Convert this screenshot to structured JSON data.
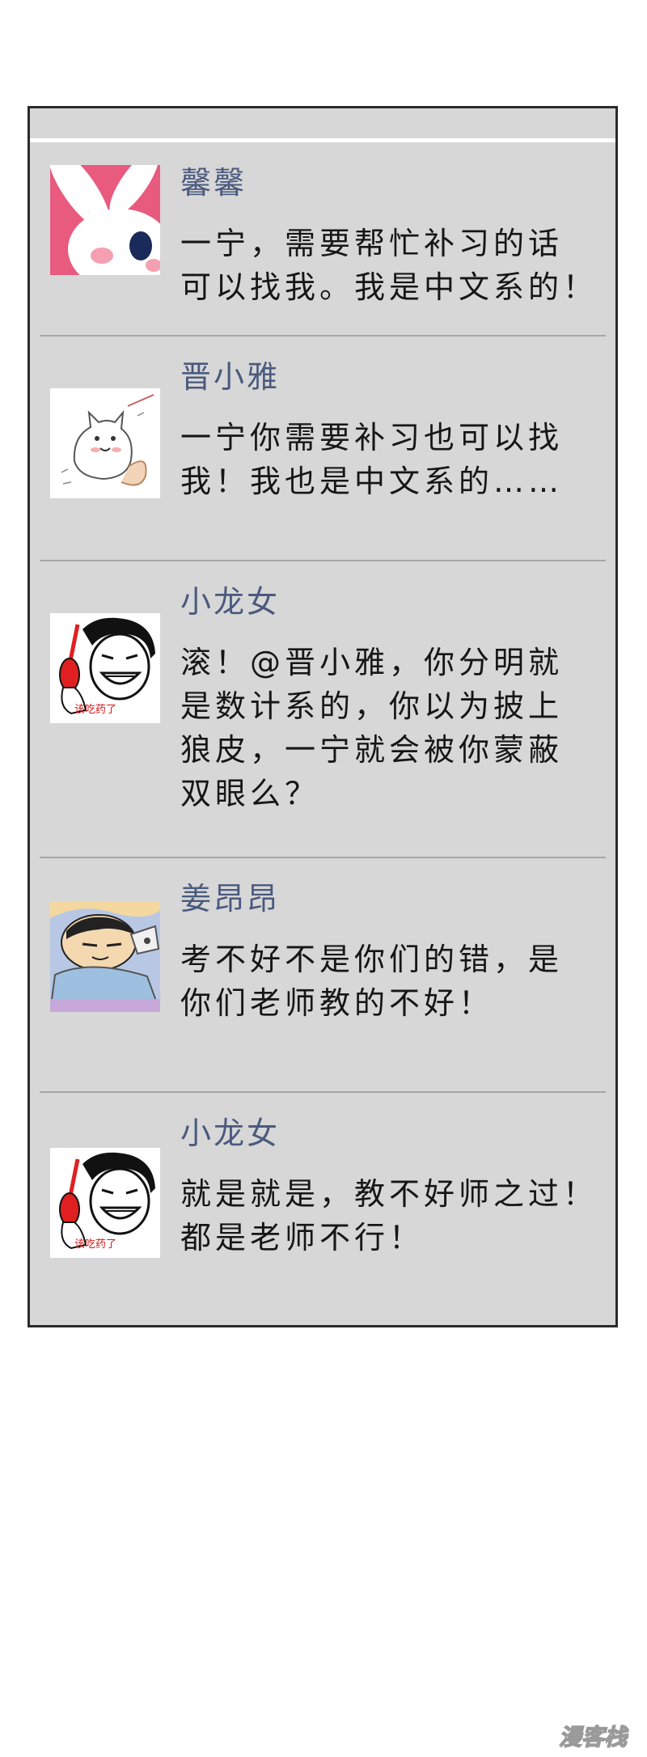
{
  "comments": [
    {
      "username": "馨馨",
      "text": "一宁，需要帮忙补习的话\n可以找我。我是中文系的！",
      "avatar_icon": "pink-bunny-avatar-icon"
    },
    {
      "username": "晋小雅",
      "text": "一宁你需要补习也可以找\n我！我也是中文系的……",
      "avatar_icon": "cat-sketch-avatar-icon"
    },
    {
      "username": "小龙女",
      "text": "滚！@晋小雅，你分明就\n是数计系的，你以为披上\n狼皮，一宁就会被你蒙蔽\n双眼么？",
      "avatar_icon": "laughing-man-meme-avatar-icon",
      "avatar_caption": "该吃药了"
    },
    {
      "username": "姜昂昂",
      "text": "考不好不是你们的错，是\n你们老师教的不好！",
      "avatar_icon": "cartoon-boy-sleeping-avatar-icon"
    },
    {
      "username": "小龙女",
      "text": "就是就是，教不好师之过！\n都是老师不行！",
      "avatar_icon": "laughing-man-meme-avatar-icon",
      "avatar_caption": "该吃药了"
    }
  ],
  "watermark": {
    "text": "漫客栈",
    "icon": "manke-watermark-logo"
  },
  "colors": {
    "panel_background": "#d7d7d7",
    "username": "#4a5a7e",
    "comment_text": "#161616"
  }
}
